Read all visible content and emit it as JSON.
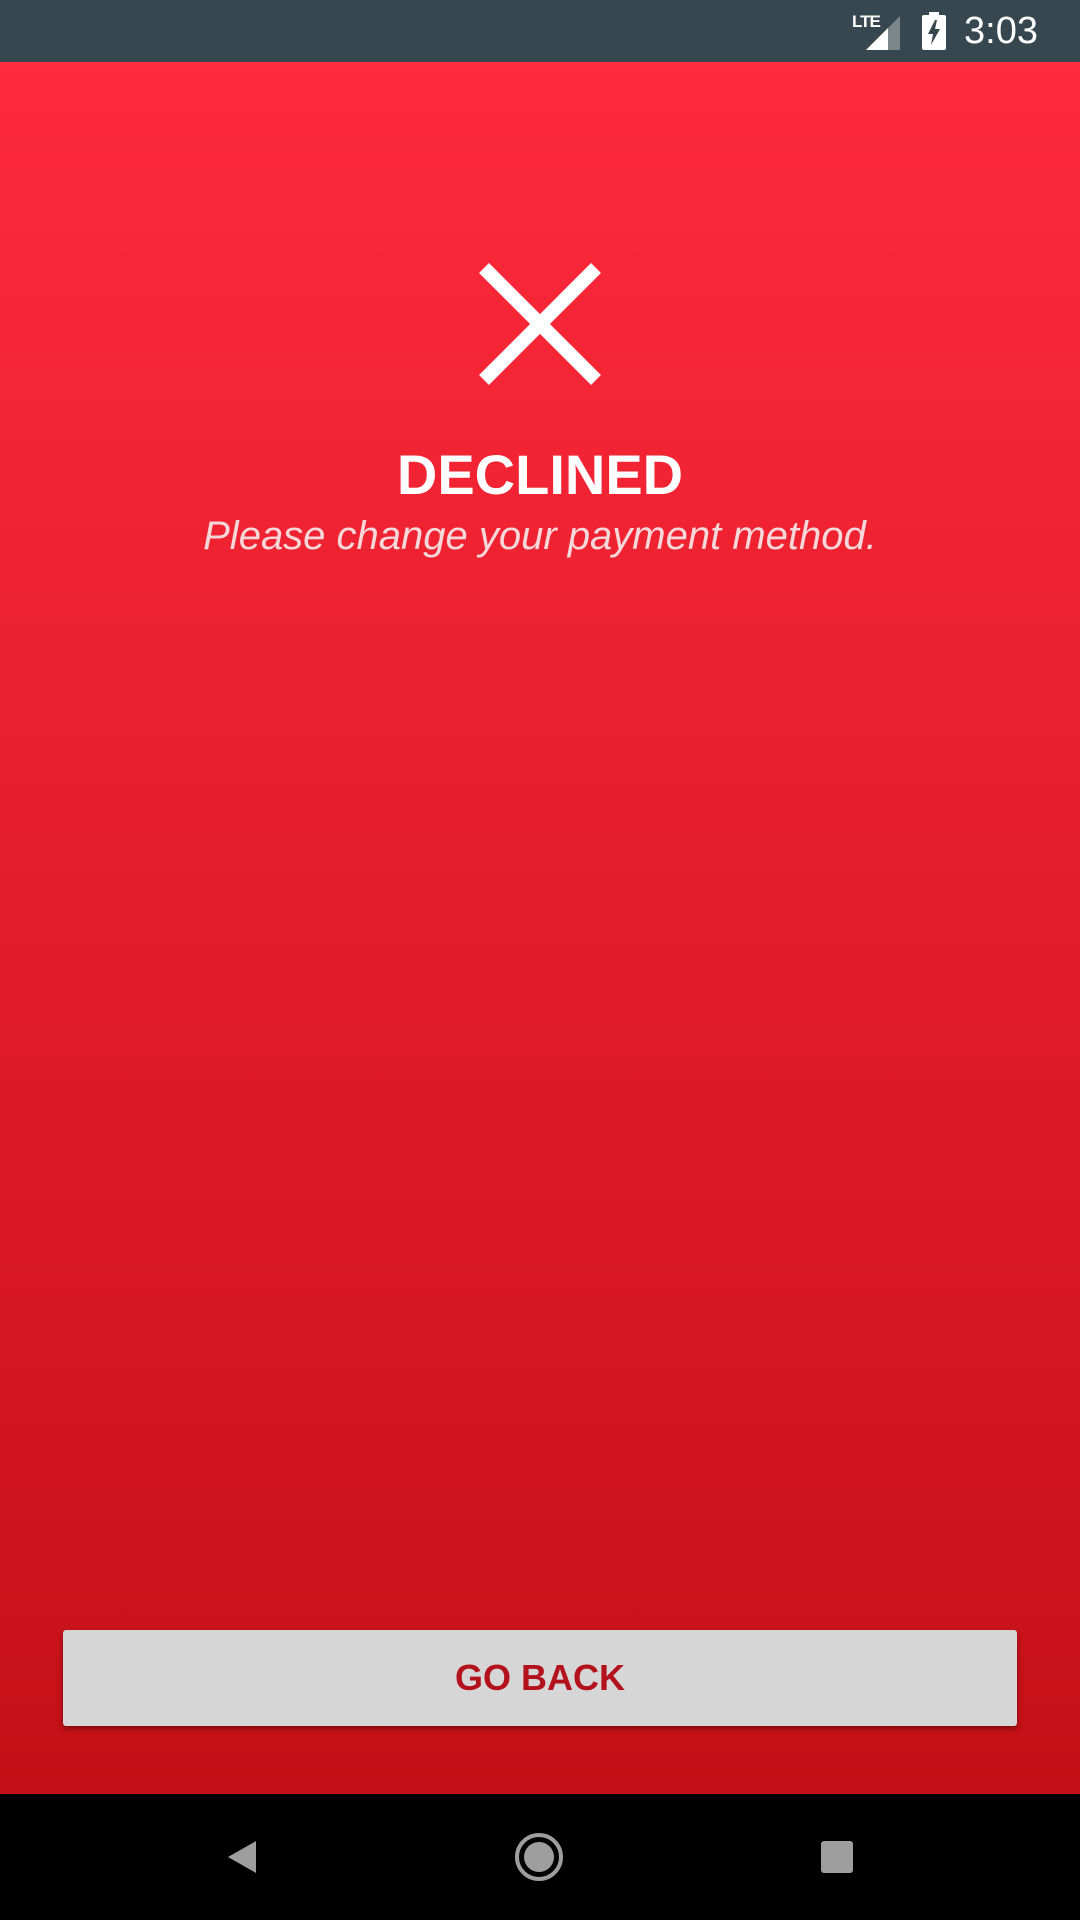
{
  "status_bar": {
    "network_label": "LTE",
    "time": "3:03",
    "icons": [
      "lte-signal-icon",
      "battery-charging-icon"
    ]
  },
  "result": {
    "icon": "close-icon",
    "title": "DECLINED",
    "message": "Please change your payment method."
  },
  "actions": {
    "go_back_label": "GO BACK"
  },
  "navigation_bar": {
    "icons": [
      "back-icon",
      "home-icon",
      "recents-icon"
    ]
  },
  "colors": {
    "status_bar": "#37474F",
    "background_top": "#FF2A3C",
    "background_bottom": "#C41016",
    "button_background": "#D6D6D6",
    "button_text": "#B3121C"
  }
}
